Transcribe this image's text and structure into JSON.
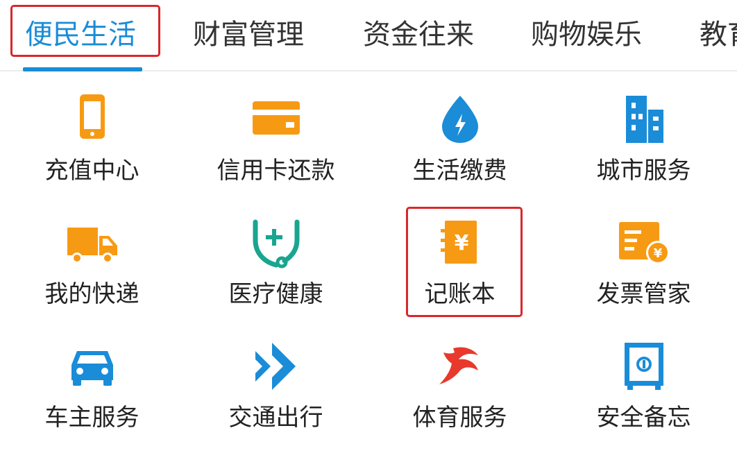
{
  "tabs": [
    {
      "label": "便民生活",
      "active": true
    },
    {
      "label": "财富管理",
      "active": false
    },
    {
      "label": "资金往来",
      "active": false
    },
    {
      "label": "购物娱乐",
      "active": false
    },
    {
      "label": "教育",
      "active": false
    }
  ],
  "grid": {
    "items": [
      {
        "label": "充值中心",
        "icon": "phone-icon"
      },
      {
        "label": "信用卡还款",
        "icon": "credit-card-icon"
      },
      {
        "label": "生活缴费",
        "icon": "water-drop-bolt-icon"
      },
      {
        "label": "城市服务",
        "icon": "city-buildings-icon"
      },
      {
        "label": "我的快递",
        "icon": "delivery-truck-icon"
      },
      {
        "label": "医疗健康",
        "icon": "medical-shield-icon"
      },
      {
        "label": "记账本",
        "icon": "ledger-book-icon"
      },
      {
        "label": "发票管家",
        "icon": "invoice-icon"
      },
      {
        "label": "车主服务",
        "icon": "car-icon"
      },
      {
        "label": "交通出行",
        "icon": "arrows-icon"
      },
      {
        "label": "体育服务",
        "icon": "sports-icon"
      },
      {
        "label": "安全备忘",
        "icon": "safe-icon"
      }
    ]
  },
  "colors": {
    "accent_blue": "#1a8cd8",
    "orange": "#f79a13",
    "teal": "#1aa58f",
    "red_highlight": "#d8272d",
    "sports_red": "#e8392c"
  }
}
